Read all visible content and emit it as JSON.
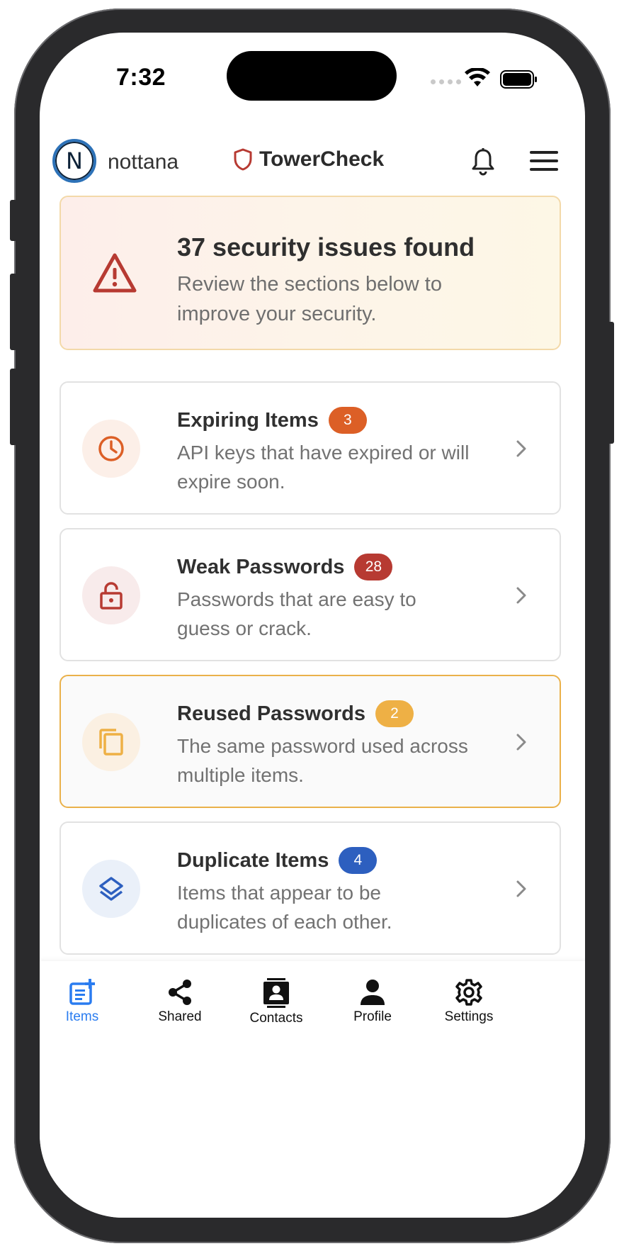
{
  "status_bar": {
    "time": "7:32"
  },
  "header": {
    "avatar_initial": "N",
    "username": "nottana",
    "app_title": "TowerCheck",
    "icons": [
      "shield-icon",
      "bell-icon",
      "hamburger-menu-icon"
    ]
  },
  "alert": {
    "title": "37 security issues found",
    "subtitle": "Review the sections below to improve your security.",
    "icon": "warning-triangle-icon",
    "color": "#b73a32"
  },
  "cards": [
    {
      "title": "Expiring Items",
      "count": "3",
      "description": "API keys that have expired or will expire soon.",
      "icon": "clock-icon",
      "badge_color": "#dc5f26"
    },
    {
      "title": "Weak Passwords",
      "count": "28",
      "description": "Passwords that are easy to guess or crack.",
      "icon": "unlocked-padlock-icon",
      "badge_color": "#b73a32"
    },
    {
      "title": "Reused Passwords",
      "count": "2",
      "description": "The same password used across multiple items.",
      "icon": "copy-icon",
      "badge_color": "#eeb045"
    },
    {
      "title": "Duplicate Items",
      "count": "4",
      "description": "Items that appear to be duplicates of each other.",
      "icon": "layers-icon",
      "badge_color": "#2d5fbf"
    }
  ],
  "tabs": [
    {
      "label": "Items",
      "icon": "items-list-icon",
      "active": true
    },
    {
      "label": "Shared",
      "icon": "share-icon",
      "active": false
    },
    {
      "label": "Contacts",
      "icon": "contacts-icon",
      "active": false
    },
    {
      "label": "Profile",
      "icon": "person-icon",
      "active": false
    },
    {
      "label": "Settings",
      "icon": "gear-icon",
      "active": false
    }
  ],
  "colors": {
    "accent": "#2a7cf0",
    "highlight_border": "#eab14a"
  }
}
